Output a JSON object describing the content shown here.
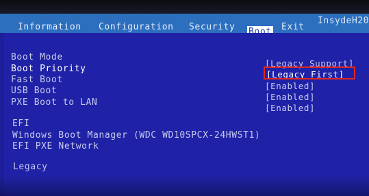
{
  "header": {
    "brand": "InsydeH20",
    "tabs": [
      "Information",
      "Configuration",
      "Security",
      "Boot",
      "Exit"
    ],
    "active_tab": "Boot"
  },
  "settings": [
    {
      "label": "Boot Mode",
      "value": "[Legacy Support]"
    },
    {
      "label": "Boot Priority",
      "value": "[Legacy First]"
    },
    {
      "label": "Fast Boot",
      "value": "[Enabled]"
    },
    {
      "label": "USB Boot",
      "value": "[Enabled]"
    },
    {
      "label": "PXE Boot to LAN",
      "value": "[Enabled]"
    }
  ],
  "efi_section": {
    "title": "EFI",
    "items": [
      "Windows Boot Manager (WDC WD10SPCX-24HWST1)",
      "EFI PXE Network"
    ]
  },
  "legacy_section": {
    "title": "Legacy"
  },
  "colors": {
    "background": "#1f22a6",
    "menubar": "#2c6fbf",
    "highlight_box": "#e2261f"
  }
}
